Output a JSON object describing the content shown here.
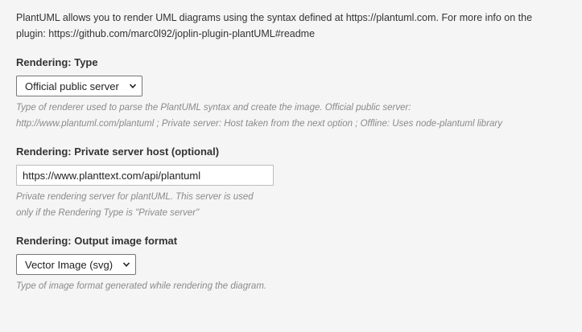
{
  "intro": {
    "line1": "PlantUML allows you to render UML diagrams using the syntax defined at https://plantuml.com. For more info on the",
    "line2": "plugin: https://github.com/marc0l92/joplin-plugin-plantUML#readme"
  },
  "rendering_type": {
    "label": "Rendering: Type",
    "selected": "Official public server",
    "description_line1": "Type of renderer used to parse the PlantUML syntax and create the image. Official public server:",
    "description_line2": "http://www.plantuml.com/plantuml ; Private server: Host taken from the next option ; Offline: Uses node-plantuml library"
  },
  "private_server": {
    "label": "Rendering: Private server host (optional)",
    "value": "https://www.planttext.com/api/plantuml",
    "description_line1": "Private rendering server for plantUML. This server is used",
    "description_line2": "only if the Rendering Type is \"Private server\""
  },
  "output_format": {
    "label": "Rendering: Output image format",
    "selected": "Vector Image (svg)",
    "description": "Type of image format generated while rendering the diagram."
  },
  "icons": {
    "dropdown": "chevron-down-icon"
  }
}
